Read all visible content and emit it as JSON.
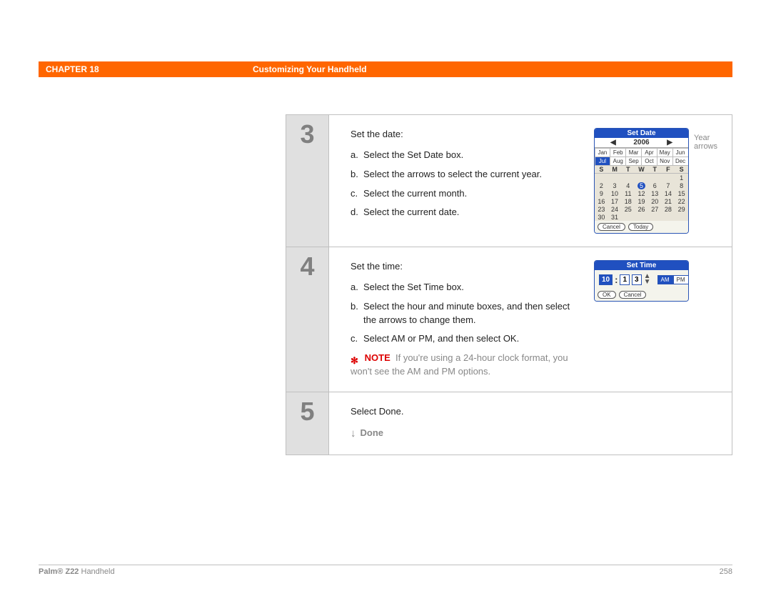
{
  "header": {
    "chapter": "CHAPTER 18",
    "title": "Customizing Your Handheld"
  },
  "steps": [
    {
      "num": "3",
      "intro": "Set the date:",
      "subs": [
        {
          "l": "a.",
          "t": "Select the Set Date box."
        },
        {
          "l": "b.",
          "t": "Select the arrows to select the current year."
        },
        {
          "l": "c.",
          "t": "Select the current month."
        },
        {
          "l": "d.",
          "t": "Select the current date."
        }
      ],
      "annot": "Year arrows"
    },
    {
      "num": "4",
      "intro": "Set the time:",
      "subs": [
        {
          "l": "a.",
          "t": "Select the Set Time box."
        },
        {
          "l": "b.",
          "t": "Select the hour and minute boxes, and then select the arrows to change them."
        },
        {
          "l": "c.",
          "t": "Select AM or PM, and then select OK."
        }
      ],
      "note_label": "NOTE",
      "note": "If you're using a 24-hour clock format, you won't see the AM and PM options."
    },
    {
      "num": "5",
      "intro": "Select Done.",
      "done": "Done"
    }
  ],
  "setDate": {
    "title": "Set Date",
    "year": "2006",
    "months": [
      "Jan",
      "Feb",
      "Mar",
      "Apr",
      "May",
      "Jun",
      "Jul",
      "Aug",
      "Sep",
      "Oct",
      "Nov",
      "Dec"
    ],
    "selectedMonthIndex": 6,
    "dow": [
      "S",
      "M",
      "T",
      "W",
      "T",
      "F",
      "S"
    ],
    "days": [
      "",
      "",
      "",
      "",
      "",
      "",
      "1",
      "2",
      "3",
      "4",
      "5",
      "6",
      "7",
      "8",
      "9",
      "10",
      "11",
      "12",
      "13",
      "14",
      "15",
      "16",
      "17",
      "18",
      "19",
      "20",
      "21",
      "22",
      "23",
      "24",
      "25",
      "26",
      "27",
      "28",
      "29",
      "30",
      "31",
      "",
      "",
      "",
      "",
      ""
    ],
    "highlightDay": "5",
    "btn_cancel": "Cancel",
    "btn_today": "Today"
  },
  "setTime": {
    "title": "Set Time",
    "hour": "10",
    "min1": "1",
    "min2": "3",
    "am": "AM",
    "pm": "PM",
    "btn_ok": "OK",
    "btn_cancel": "Cancel"
  },
  "footer": {
    "left_bold": "Palm®",
    "left_model": "Z22",
    "left_rest": "Handheld",
    "page": "258"
  }
}
